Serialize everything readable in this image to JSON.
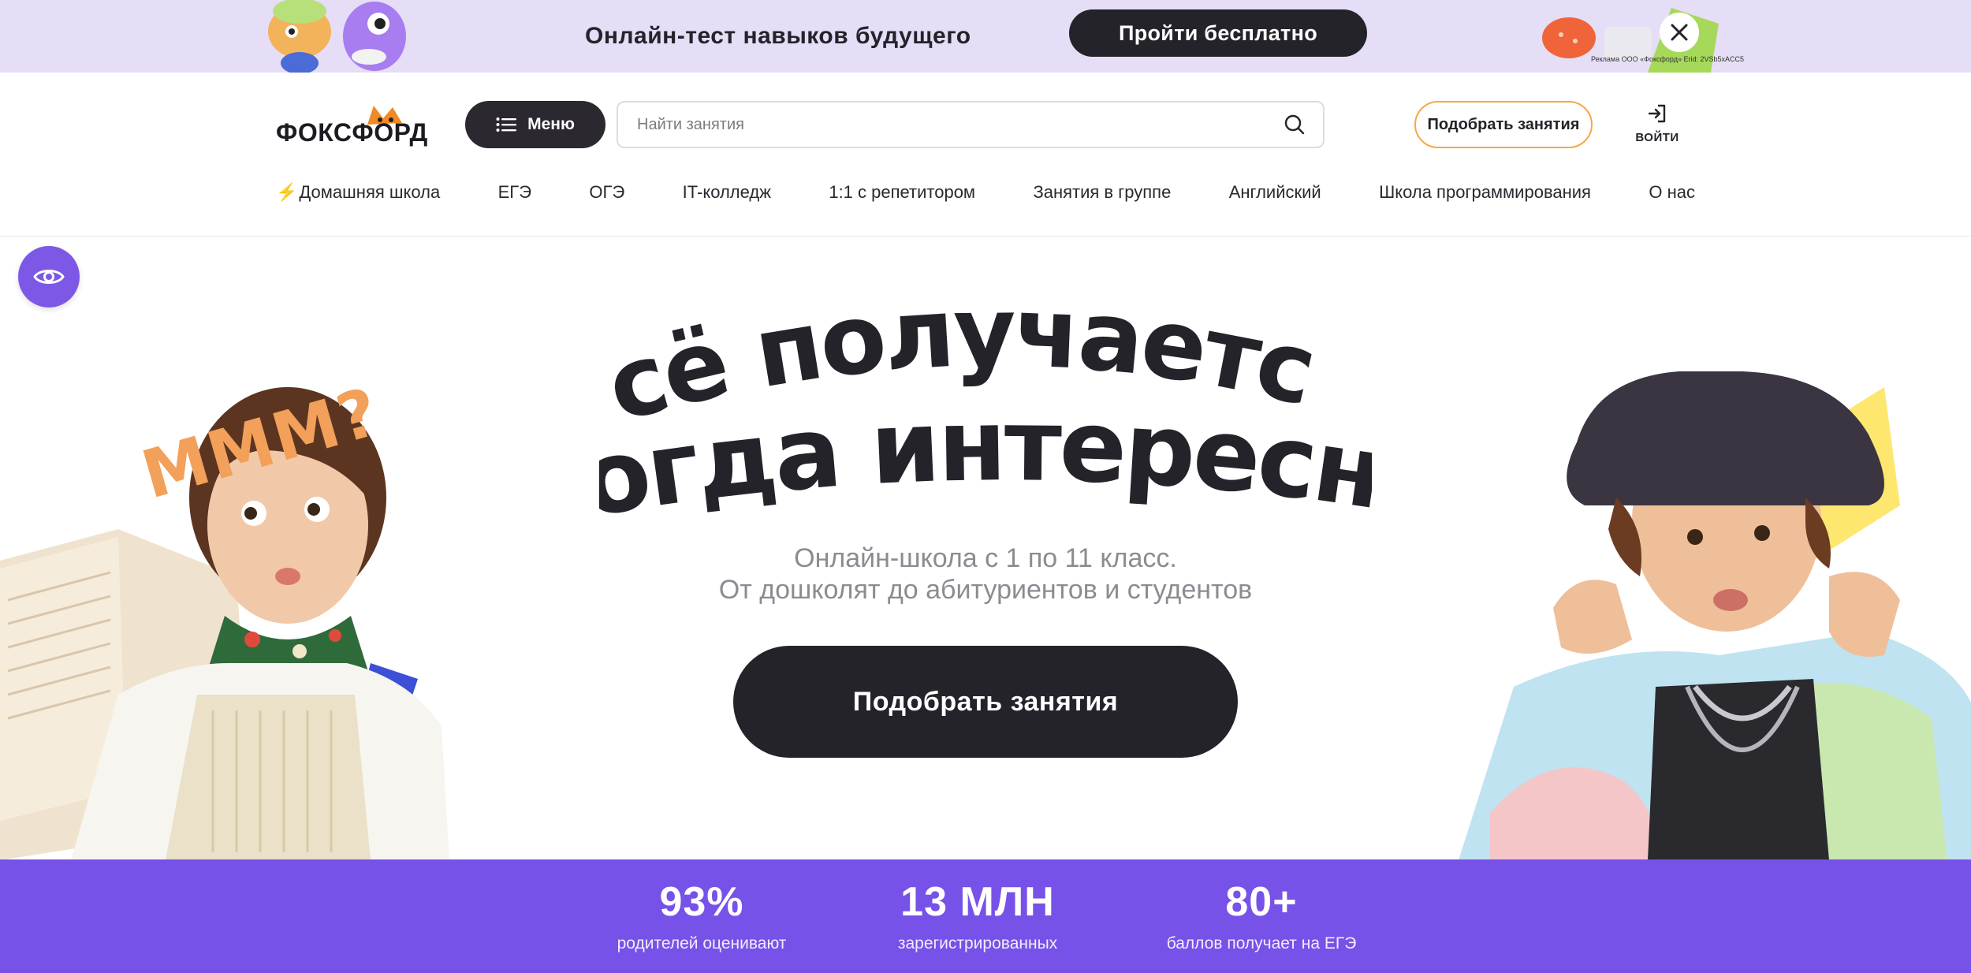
{
  "promo": {
    "text": "Онлайн-тест навыков будущего",
    "button": "Пройти бесплатно",
    "ad_note": "Реклама ООО «Фоксфорд» Erid: 2VSb5xACC5"
  },
  "header": {
    "logo": "ФОКСФОРД",
    "menu_button": "Меню",
    "search_placeholder": "Найти занятия",
    "pick_button": "Подобрать занятия",
    "login": "ВОЙТИ"
  },
  "nav": [
    {
      "label": "Домашняя школа"
    },
    {
      "label": "ЕГЭ"
    },
    {
      "label": "ОГЭ"
    },
    {
      "label": "IT-колледж"
    },
    {
      "label": "1:1 с репетитором"
    },
    {
      "label": "Занятия в группе"
    },
    {
      "label": "Английский"
    },
    {
      "label": "Школа программирования"
    },
    {
      "label": "О нас"
    }
  ],
  "hero": {
    "title_line1": "всё получается,",
    "title_line2": "когда интересно",
    "subtitle_line1": "Онлайн-школа с 1 по 11 класс.",
    "subtitle_line2": "От дошколят до абитуриентов и студентов",
    "cta": "Подобрать занятия",
    "sticker": "МММ?"
  },
  "stats": [
    {
      "value": "93%",
      "label": "родителей оценивают"
    },
    {
      "value": "13 МЛН",
      "label": "зарегистрированных"
    },
    {
      "value": "80+",
      "label": "баллов получает на ЕГЭ"
    }
  ],
  "colors": {
    "accent_purple": "#7752e8",
    "dark": "#25232a",
    "orange": "#f4a84a",
    "promo_bg": "#e6ddf6"
  }
}
